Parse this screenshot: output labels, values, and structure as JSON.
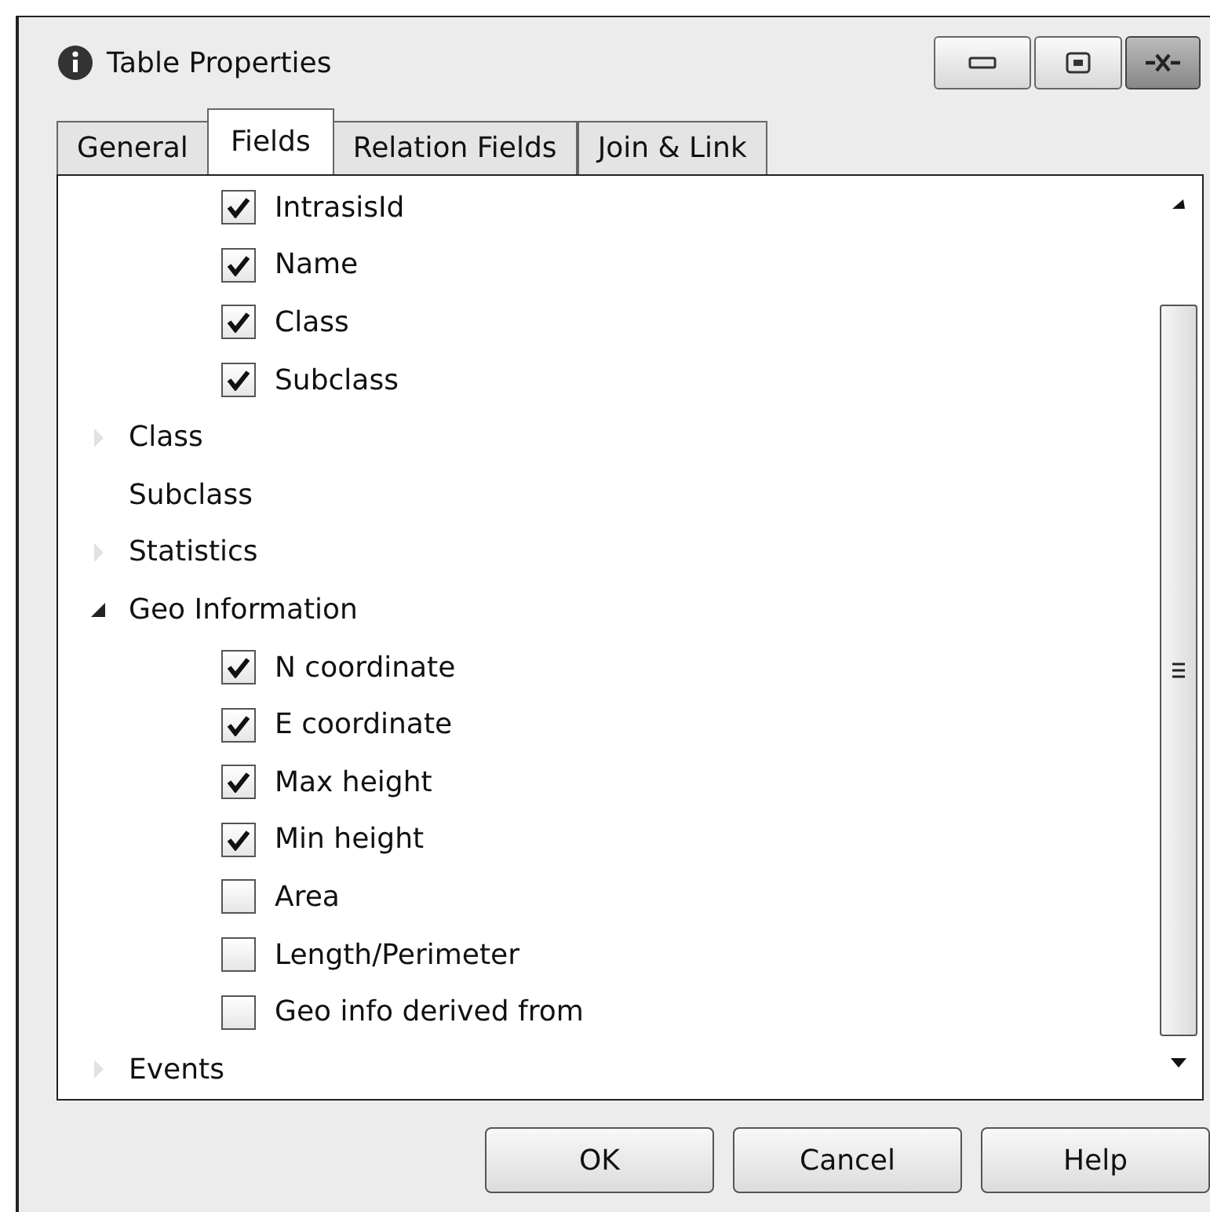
{
  "window": {
    "title": "Table Properties"
  },
  "tabs": [
    {
      "label": "General",
      "selected": false
    },
    {
      "label": "Fields",
      "selected": true
    },
    {
      "label": "Relation Fields",
      "selected": false
    },
    {
      "label": "Join & Link",
      "selected": false
    }
  ],
  "tree": {
    "items": [
      {
        "kind": "group",
        "children": [
          {
            "kind": "checkbox",
            "label": "IntrasisId",
            "checked": true
          },
          {
            "kind": "checkbox",
            "label": "Name",
            "checked": true
          },
          {
            "kind": "checkbox",
            "label": "Class",
            "checked": true
          },
          {
            "kind": "checkbox",
            "label": "Subclass",
            "checked": true
          }
        ]
      },
      {
        "kind": "node",
        "label": "Class",
        "expanded": false
      },
      {
        "kind": "leaf",
        "label": "Subclass"
      },
      {
        "kind": "node",
        "label": "Statistics",
        "expanded": false
      },
      {
        "kind": "node",
        "label": "Geo Information",
        "expanded": true,
        "children": [
          {
            "kind": "checkbox",
            "label": "N coordinate",
            "checked": true
          },
          {
            "kind": "checkbox",
            "label": "E coordinate",
            "checked": true
          },
          {
            "kind": "checkbox",
            "label": "Max height",
            "checked": true
          },
          {
            "kind": "checkbox",
            "label": "Min height",
            "checked": true
          },
          {
            "kind": "checkbox",
            "label": "Area",
            "checked": false
          },
          {
            "kind": "checkbox",
            "label": "Length/Perimeter",
            "checked": false
          },
          {
            "kind": "checkbox",
            "label": "Geo info derived from",
            "checked": false
          }
        ]
      },
      {
        "kind": "node",
        "label": "Events",
        "expanded": false
      }
    ]
  },
  "buttons": [
    "OK",
    "Cancel",
    "Help"
  ]
}
